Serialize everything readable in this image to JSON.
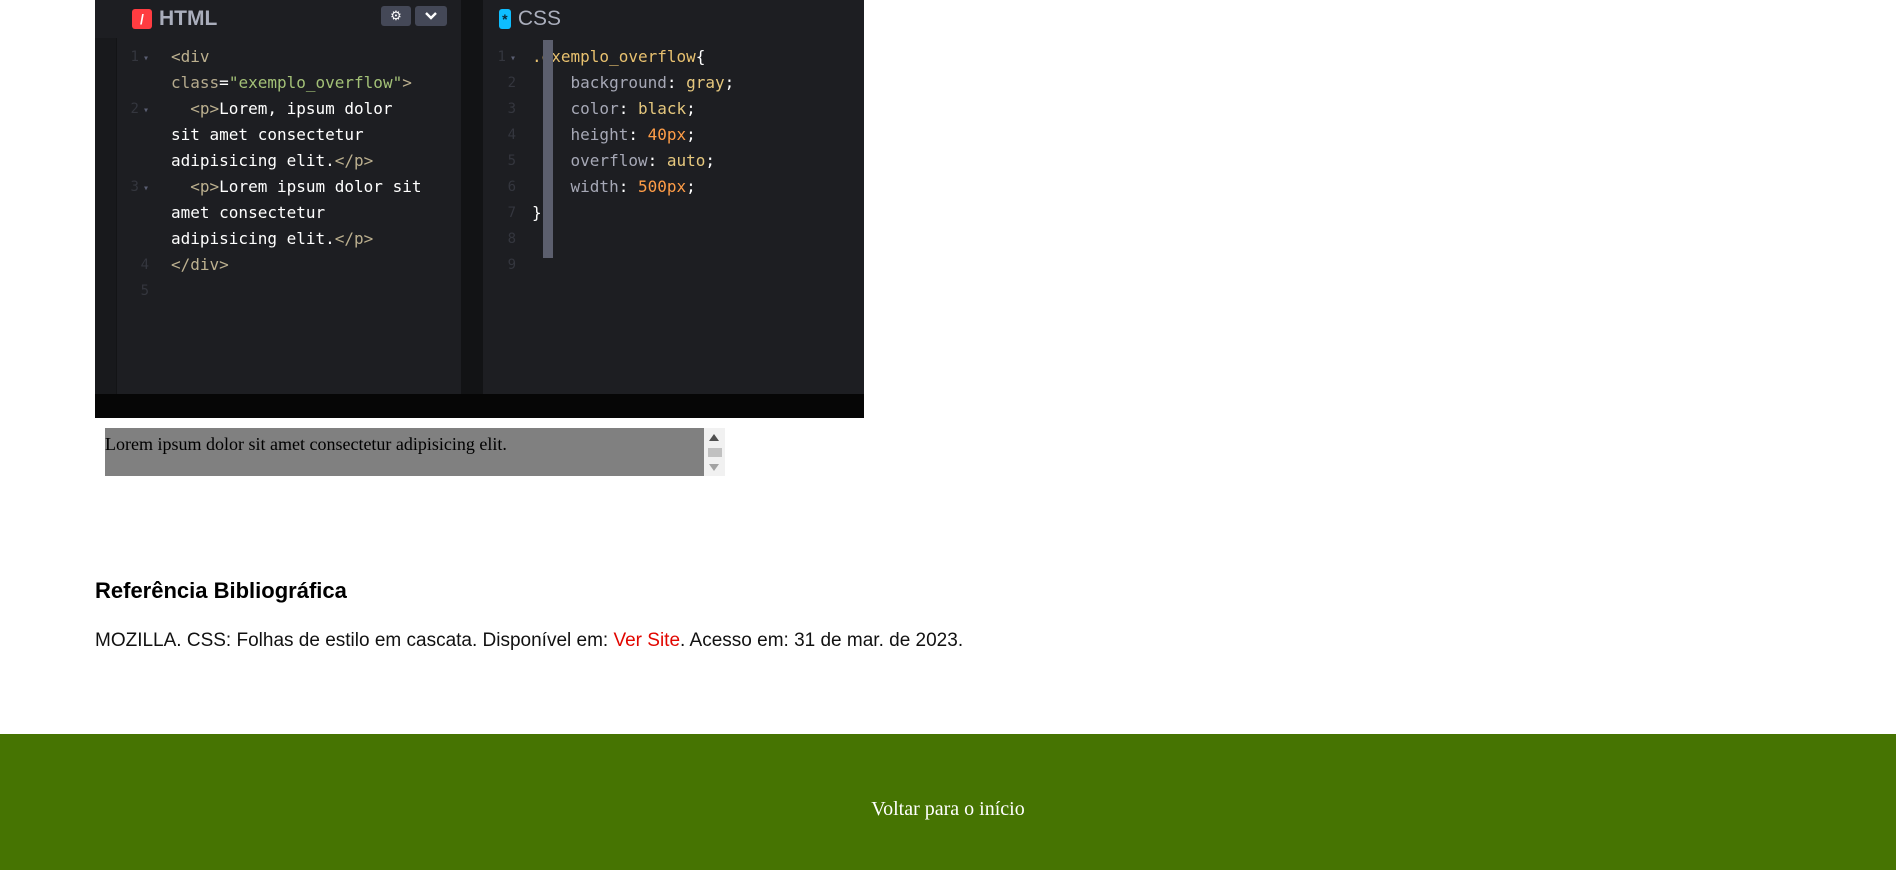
{
  "editor": {
    "html_tab": "HTML",
    "css_tab": "CSS",
    "html_badge": "/",
    "css_badge": "*",
    "settings_icon": "gear-icon",
    "collapse_icon": "chevron-down-icon",
    "html_lines": [
      {
        "n": "1",
        "fold": true,
        "segments": [
          [
            "tag",
            "<div"
          ]
        ]
      },
      {
        "n": "",
        "fold": false,
        "segments": [
          [
            "attr",
            "class"
          ],
          [
            "punc",
            "="
          ],
          [
            "str",
            "\"exemplo_overflow\""
          ],
          [
            "tag",
            ">"
          ]
        ]
      },
      {
        "n": "2",
        "fold": true,
        "segments": [
          [
            "txt",
            "  "
          ],
          [
            "tag",
            "<p>"
          ],
          [
            "txt",
            "Lorem, ipsum dolor"
          ]
        ]
      },
      {
        "n": "",
        "fold": false,
        "segments": [
          [
            "txt",
            "sit amet consectetur"
          ]
        ]
      },
      {
        "n": "",
        "fold": false,
        "segments": [
          [
            "txt",
            "adipisicing elit."
          ],
          [
            "tag",
            "</p>"
          ]
        ]
      },
      {
        "n": "3",
        "fold": true,
        "segments": [
          [
            "txt",
            "  "
          ],
          [
            "tag",
            "<p>"
          ],
          [
            "txt",
            "Lorem ipsum dolor sit"
          ]
        ]
      },
      {
        "n": "",
        "fold": false,
        "segments": [
          [
            "txt",
            "amet consectetur"
          ]
        ]
      },
      {
        "n": "",
        "fold": false,
        "segments": [
          [
            "txt",
            "adipisicing elit."
          ],
          [
            "tag",
            "</p>"
          ]
        ]
      },
      {
        "n": "4",
        "fold": false,
        "segments": [
          [
            "tag",
            "</div>"
          ]
        ]
      },
      {
        "n": "5",
        "fold": false,
        "segments": []
      }
    ],
    "css_lines": [
      {
        "n": "1",
        "fold": true,
        "segments": [
          [
            "sel",
            ".exemplo_overflow"
          ],
          [
            "punc",
            "{"
          ]
        ]
      },
      {
        "n": "2",
        "fold": false,
        "segments": [
          [
            "txt",
            "    "
          ],
          [
            "prop",
            "background"
          ],
          [
            "punc",
            ": "
          ],
          [
            "val",
            "gray"
          ],
          [
            "punc",
            ";"
          ]
        ]
      },
      {
        "n": "3",
        "fold": false,
        "segments": [
          [
            "txt",
            "    "
          ],
          [
            "prop",
            "color"
          ],
          [
            "punc",
            ": "
          ],
          [
            "val",
            "black"
          ],
          [
            "punc",
            ";"
          ]
        ]
      },
      {
        "n": "4",
        "fold": false,
        "segments": [
          [
            "txt",
            "    "
          ],
          [
            "prop",
            "height"
          ],
          [
            "punc",
            ": "
          ],
          [
            "num",
            "40px"
          ],
          [
            "punc",
            ";"
          ]
        ]
      },
      {
        "n": "5",
        "fold": false,
        "segments": [
          [
            "txt",
            "    "
          ],
          [
            "prop",
            "overflow"
          ],
          [
            "punc",
            ": "
          ],
          [
            "val",
            "auto"
          ],
          [
            "punc",
            ";"
          ]
        ]
      },
      {
        "n": "6",
        "fold": false,
        "segments": [
          [
            "txt",
            "    "
          ],
          [
            "prop",
            "width"
          ],
          [
            "punc",
            ": "
          ],
          [
            "num",
            "500px"
          ],
          [
            "punc",
            ";"
          ]
        ]
      },
      {
        "n": "7",
        "fold": false,
        "segments": [
          [
            "punc",
            "}"
          ]
        ]
      },
      {
        "n": "8",
        "fold": false,
        "segments": []
      },
      {
        "n": "9",
        "fold": false,
        "segments": []
      }
    ]
  },
  "demo": {
    "text": "Lorem ipsum dolor sit amet consectetur adipisicing elit."
  },
  "references": {
    "title": "Referência Bibliográfica",
    "text_before": "MOZILLA. CSS: Folhas de estilo em cascata. Disponível em: ",
    "link": "Ver Site",
    "text_after": ". Acesso em: 31 de mar. de 2023."
  },
  "footer": {
    "back_link": "Voltar para o início",
    "background": "#467402"
  },
  "colors": {
    "accent_link": "#e10600",
    "footer_green": "#467402",
    "editor_bg": "#1d1e22"
  }
}
